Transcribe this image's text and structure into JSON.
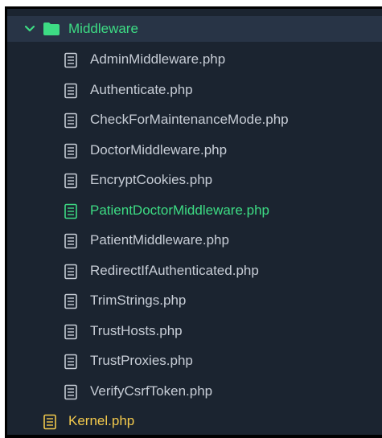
{
  "folder": {
    "name": "Middleware",
    "state_icon": "chevron-down-icon",
    "icon": "folder-icon",
    "color": "#3ddc84"
  },
  "files": [
    {
      "name": "AdminMiddleware.php",
      "status": "normal"
    },
    {
      "name": "Authenticate.php",
      "status": "normal"
    },
    {
      "name": "CheckForMaintenanceMode.php",
      "status": "normal"
    },
    {
      "name": "DoctorMiddleware.php",
      "status": "normal"
    },
    {
      "name": "EncryptCookies.php",
      "status": "normal"
    },
    {
      "name": "PatientDoctorMiddleware.php",
      "status": "modified"
    },
    {
      "name": "PatientMiddleware.php",
      "status": "normal"
    },
    {
      "name": "RedirectIfAuthenticated.php",
      "status": "normal"
    },
    {
      "name": "TrimStrings.php",
      "status": "normal"
    },
    {
      "name": "TrustHosts.php",
      "status": "normal"
    },
    {
      "name": "TrustProxies.php",
      "status": "normal"
    },
    {
      "name": "VerifyCsrfToken.php",
      "status": "normal"
    }
  ],
  "kernel": {
    "name": "Kernel.php",
    "color": "#f2c94c"
  },
  "colors": {
    "background": "#1b2430",
    "selected_row": "#283446",
    "file_text": "#c7cdd6",
    "modified_text": "#3ddc84"
  }
}
